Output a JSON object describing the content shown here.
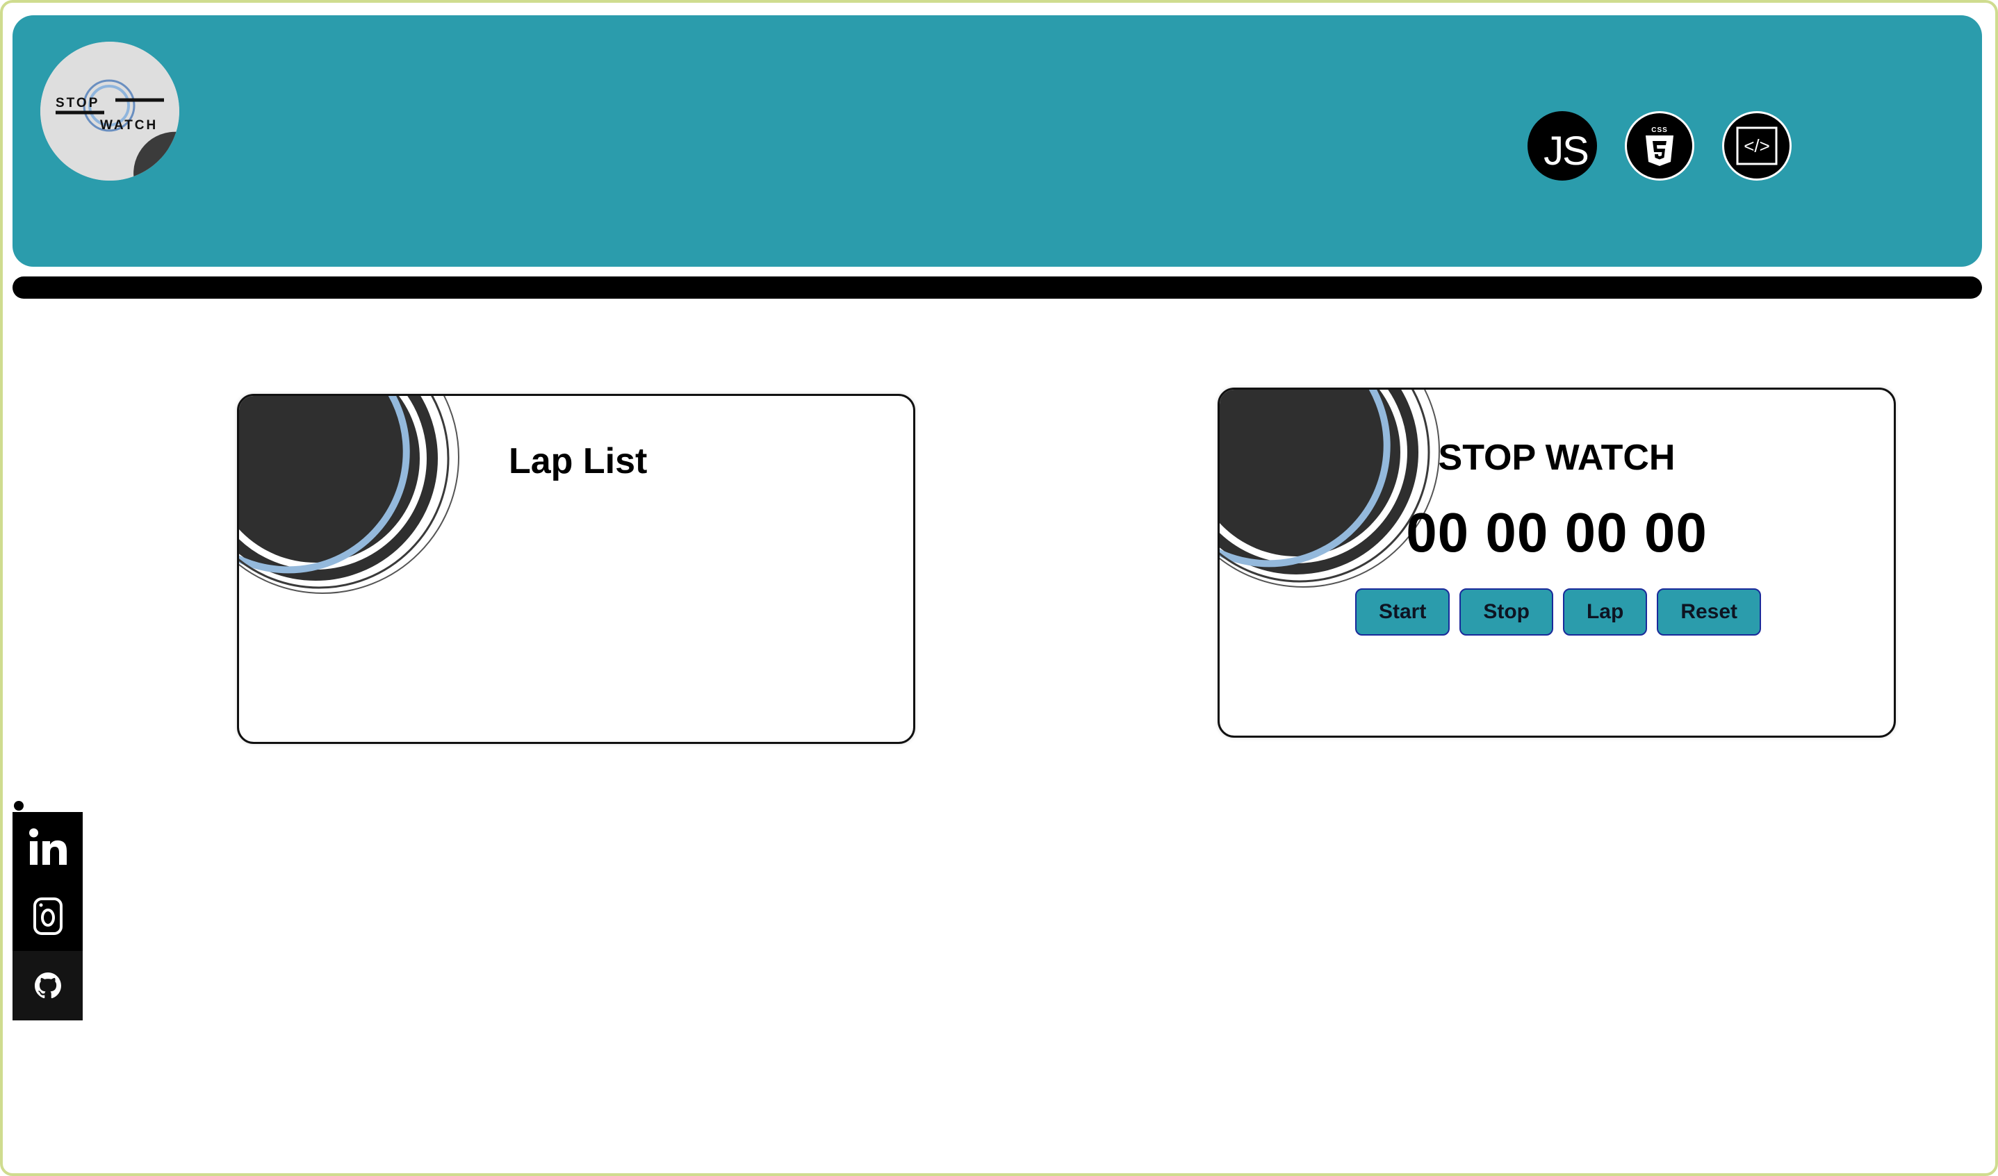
{
  "header": {
    "logo": {
      "text_top": "STOP",
      "text_bottom": "WATCH"
    },
    "tech_icons": [
      {
        "name": "javascript-icon",
        "label": "JS"
      },
      {
        "name": "css3-icon",
        "label": ""
      },
      {
        "name": "code-icon",
        "label": ""
      }
    ]
  },
  "lap_card": {
    "title": "Lap List"
  },
  "stopwatch_card": {
    "title": "STOP WATCH",
    "time": "00 00 00 00",
    "buttons": {
      "start": "Start",
      "stop": "Stop",
      "lap": "Lap",
      "reset": "Reset"
    }
  },
  "social": [
    {
      "name": "linkedin-icon"
    },
    {
      "name": "instagram-icon"
    },
    {
      "name": "github-icon"
    }
  ],
  "colors": {
    "header_bg": "#2b9cac",
    "button_bg": "#2b9cac",
    "page_border": "#cfdc8f"
  }
}
